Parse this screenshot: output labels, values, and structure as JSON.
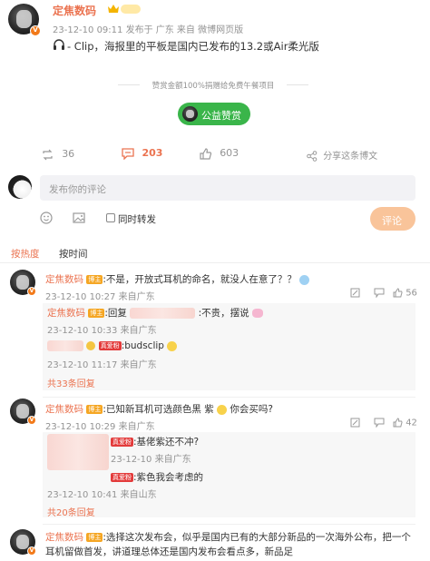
{
  "post": {
    "author": "定焦数码",
    "meta": "23-12-10 09:11  发布于 广东  来自 微博网页版",
    "text": "- Clip，海报里的平板是国内已发布的13.2或Air柔光版",
    "donation_note": "赞赏金额100%捐赠给免费午餐项目",
    "donate_button": "公益赞赏",
    "stats": {
      "reposts": "36",
      "comments": "203",
      "likes": "603",
      "share": "分享这条博文"
    }
  },
  "composer": {
    "placeholder": "发布你的评论",
    "also_repost": "同时转发",
    "submit": "评论"
  },
  "sort_tabs": {
    "hot": "按热度",
    "time": "按时间"
  },
  "comments": [
    {
      "author": "定焦数码",
      "tag": "博主",
      "text": ":不是，开放式耳机的命名，就没人在意了？？",
      "meta": "23-12-10 10:27 来自广东",
      "likes": "56",
      "replies": [
        {
          "text_prefix": ":回复",
          "text": ":不贵，摆说",
          "meta": "23-12-10 10:33 来自广东"
        },
        {
          "badge": "真爱粉",
          "text": ":budsclip",
          "meta": "23-12-10 11:17 来自广东"
        }
      ],
      "more": "共33条回复"
    },
    {
      "author": "定焦数码",
      "tag": "博主",
      "text": ":已知新耳机可选颜色黑 紫",
      "text2": "你会买吗?",
      "meta": "23-12-10 10:29 来自广东",
      "likes": "42",
      "replies": [
        {
          "badge": "真爱粉",
          "text": ":基佬紫还不冲?",
          "meta": "23-12-10 来自广东"
        },
        {
          "badge": "真爱粉",
          "text": ":紫色我会考虑的",
          "meta": "23-12-10 10:41 来自山东"
        }
      ],
      "more": "共20条回复"
    },
    {
      "author": "定焦数码",
      "tag": "博主",
      "text": ":选择这次发布会，似乎是国内已有的大部分新品的一次海外公布，把一个耳机留做首发，讲道理总体还是国内发布会看点多，新品足"
    }
  ],
  "colors": {
    "accent": "#eb7350",
    "green": "#3ab54a",
    "submit": "#f9c49a"
  }
}
